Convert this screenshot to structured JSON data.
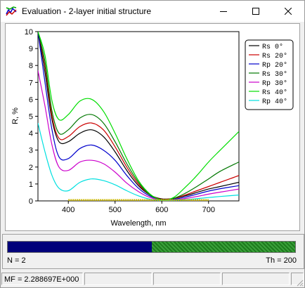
{
  "window": {
    "title": "Evaluation - 2-layer initial structure",
    "icon": "spectrum-app-icon",
    "controls": [
      "minimize-icon",
      "maximize-icon",
      "close-icon"
    ]
  },
  "chart_data": {
    "type": "line",
    "xlabel": "Wavelength, nm",
    "ylabel": "R, %",
    "xlim": [
      335,
      765
    ],
    "ylim": [
      0,
      10
    ],
    "xticks": [
      400,
      500,
      600,
      700
    ],
    "yticks": [
      0,
      1,
      2,
      3,
      4,
      5,
      6,
      7,
      8,
      9,
      10
    ],
    "grid": false,
    "legend_position": "top-right",
    "marker_band": {
      "x_start": 400,
      "x_end": 700,
      "y": 0,
      "color": "#c8b400"
    },
    "series": [
      {
        "name": "Rs  0°",
        "color": "#000000",
        "x": [
          335,
          350,
          365,
          380,
          400,
          425,
          450,
          475,
          500,
          525,
          550,
          575,
          600,
          625,
          650,
          675,
          700,
          725,
          765
        ],
        "y": [
          10,
          7.6,
          4.8,
          3.5,
          3.5,
          4.0,
          4.2,
          3.8,
          2.9,
          1.8,
          0.9,
          0.35,
          0.12,
          0.15,
          0.3,
          0.5,
          0.7,
          0.85,
          1.1
        ]
      },
      {
        "name": "Rs 20°",
        "color": "#cc0000",
        "x": [
          335,
          350,
          365,
          380,
          400,
          425,
          450,
          475,
          500,
          525,
          550,
          575,
          600,
          625,
          650,
          675,
          700,
          725,
          765
        ],
        "y": [
          10,
          8.0,
          5.0,
          3.7,
          3.8,
          4.4,
          4.6,
          4.2,
          3.2,
          2.0,
          1.0,
          0.35,
          0.1,
          0.15,
          0.35,
          0.6,
          0.85,
          1.1,
          1.5
        ]
      },
      {
        "name": "Rp 20°",
        "color": "#0000cc",
        "x": [
          335,
          350,
          365,
          380,
          400,
          425,
          450,
          475,
          500,
          525,
          550,
          575,
          600,
          625,
          650,
          675,
          700,
          725,
          765
        ],
        "y": [
          10,
          7.0,
          4.2,
          2.6,
          2.5,
          3.1,
          3.3,
          3.0,
          2.4,
          1.5,
          0.75,
          0.28,
          0.08,
          0.1,
          0.22,
          0.4,
          0.58,
          0.72,
          0.9
        ]
      },
      {
        "name": "Rs 30°",
        "color": "#007700",
        "x": [
          335,
          350,
          365,
          380,
          400,
          425,
          450,
          475,
          500,
          525,
          550,
          575,
          600,
          625,
          650,
          675,
          700,
          725,
          765
        ],
        "y": [
          10,
          8.2,
          5.3,
          4.0,
          4.2,
          4.9,
          5.1,
          4.6,
          3.5,
          2.2,
          1.1,
          0.35,
          0.08,
          0.15,
          0.45,
          0.85,
          1.3,
          1.75,
          2.3
        ]
      },
      {
        "name": "Rp 30°",
        "color": "#cc00cc",
        "x": [
          335,
          350,
          365,
          380,
          400,
          425,
          450,
          475,
          500,
          525,
          550,
          575,
          600,
          625,
          650,
          675,
          700,
          725,
          765
        ],
        "y": [
          7.7,
          5.6,
          3.3,
          2.0,
          1.8,
          2.3,
          2.4,
          2.2,
          1.7,
          1.05,
          0.55,
          0.2,
          0.05,
          0.06,
          0.14,
          0.26,
          0.4,
          0.52,
          0.7
        ]
      },
      {
        "name": "Rs 40°",
        "color": "#00dd00",
        "x": [
          335,
          350,
          365,
          380,
          400,
          425,
          450,
          475,
          500,
          525,
          550,
          575,
          600,
          625,
          650,
          675,
          700,
          725,
          765
        ],
        "y": [
          10,
          8.6,
          5.9,
          4.8,
          5.1,
          5.9,
          6.0,
          5.3,
          4.0,
          2.5,
          1.2,
          0.4,
          0.05,
          0.2,
          0.8,
          1.5,
          2.3,
          3.0,
          4.1
        ]
      },
      {
        "name": "Rp 40°",
        "color": "#00e0e0",
        "x": [
          335,
          350,
          365,
          380,
          400,
          425,
          450,
          475,
          500,
          525,
          550,
          575,
          600,
          625,
          650,
          675,
          700,
          725,
          765
        ],
        "y": [
          4.6,
          2.9,
          1.5,
          0.75,
          0.6,
          1.1,
          1.3,
          1.2,
          0.95,
          0.6,
          0.3,
          0.1,
          0.02,
          0.03,
          0.07,
          0.13,
          0.2,
          0.26,
          0.35
        ]
      }
    ]
  },
  "progress": {
    "fraction": 0.5,
    "fill_color": "#00007a",
    "left_label": "N = 2",
    "right_label": "Th = 200"
  },
  "status": {
    "mf": "MF =  2.288697E+000",
    "cells": [
      "",
      "",
      "",
      ""
    ]
  }
}
